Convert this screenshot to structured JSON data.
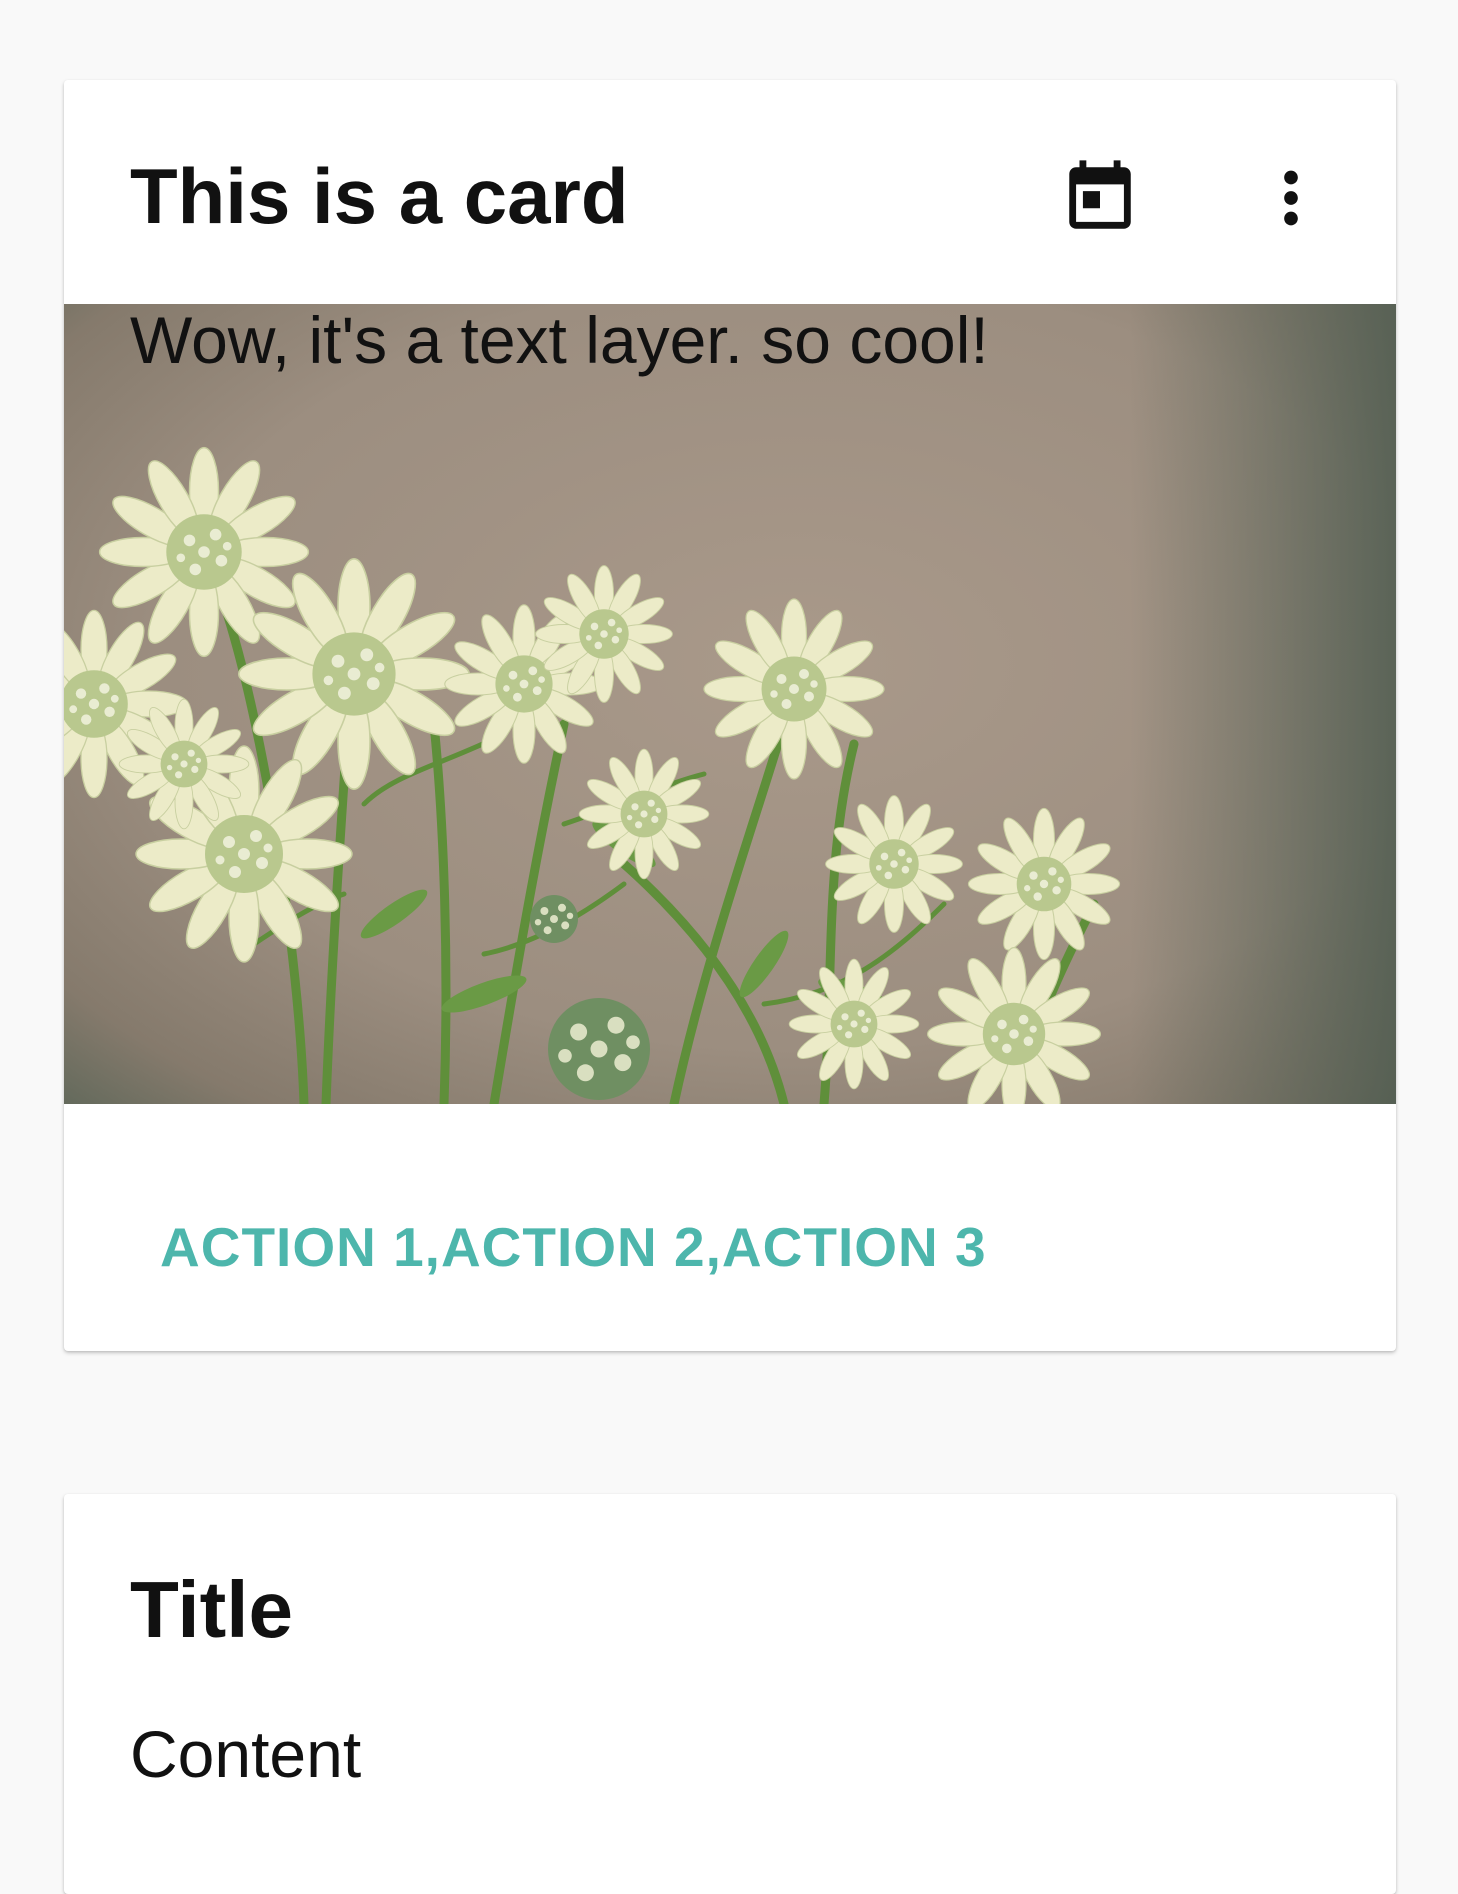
{
  "card1": {
    "title": "This is a card",
    "header_icons": [
      "calendar-icon",
      "more-vert-icon"
    ],
    "media_text": "Wow, it's a text layer. so cool!",
    "actions_label": "ACTION 1,ACTION 2,ACTION 3"
  },
  "card2": {
    "title": "Title",
    "content": "Content"
  },
  "colors": {
    "background": "#f9f9f9",
    "card": "#ffffff",
    "text": "#111111",
    "accent": "#4db6ac"
  }
}
